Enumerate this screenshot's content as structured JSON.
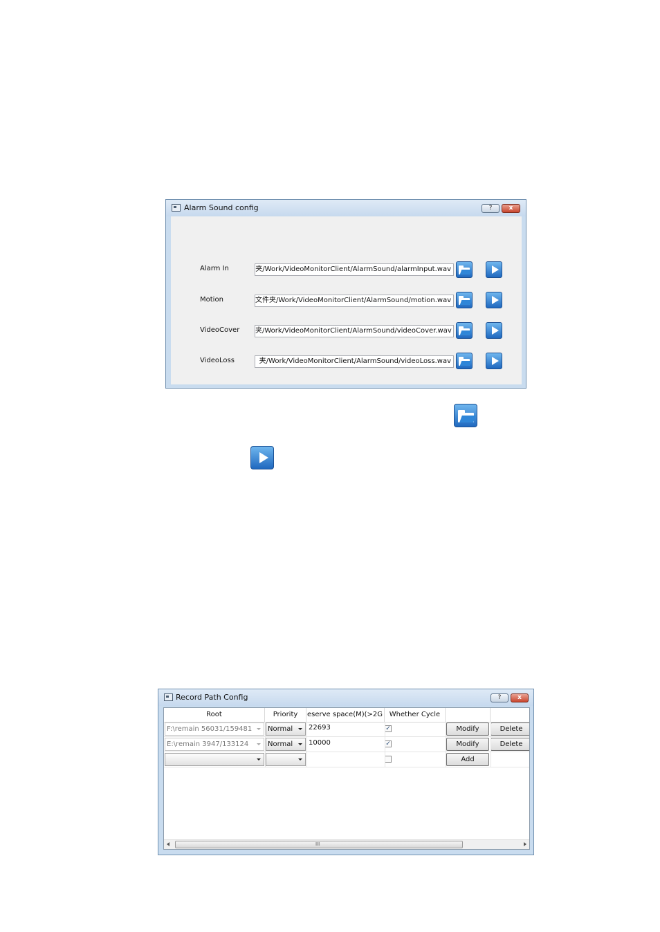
{
  "alarm_window": {
    "title": "Alarm Sound config",
    "help_label": "?",
    "close_label": "x",
    "rows": [
      {
        "label": "Alarm In",
        "path": "夹/Work/VideoMonitorClient/AlarmSound/alarmInput.wav"
      },
      {
        "label": "Motion",
        "path": "文件夹/Work/VideoMonitorClient/AlarmSound/motion.wav"
      },
      {
        "label": "VideoCover",
        "path": "夹/Work/VideoMonitorClient/AlarmSound/videoCover.wav"
      },
      {
        "label": "VideoLoss",
        "path": "夹/Work/VideoMonitorClient/AlarmSound/videoLoss.wav"
      }
    ]
  },
  "icons": {
    "browse": "folder-open-icon",
    "play": "play-icon"
  },
  "record_window": {
    "title": "Record Path Config",
    "help_label": "?",
    "close_label": "x",
    "columns": {
      "root": "Root",
      "priority": "Priority",
      "reserve": "eserve space(M)(>2G",
      "cycle": "Whether Cycle"
    },
    "rows": [
      {
        "root": "F:\\remain 56031/159481",
        "priority": "Normal",
        "reserve": "22693",
        "cycle_checked": "✓",
        "modify_label": "Modify",
        "delete_label": "Delete"
      },
      {
        "root": "E:\\remain 3947/133124",
        "priority": "Normal",
        "reserve": "10000",
        "cycle_checked": "✓",
        "modify_label": "Modify",
        "delete_label": "Delete"
      }
    ],
    "new_row": {
      "root": "",
      "priority": "",
      "reserve": "",
      "add_label": "Add"
    },
    "scroll_grip": "III"
  },
  "colors": {
    "accent_blue": "#1f68bf",
    "title_bar": "#c9dcef",
    "close_red": "#c8462f"
  }
}
